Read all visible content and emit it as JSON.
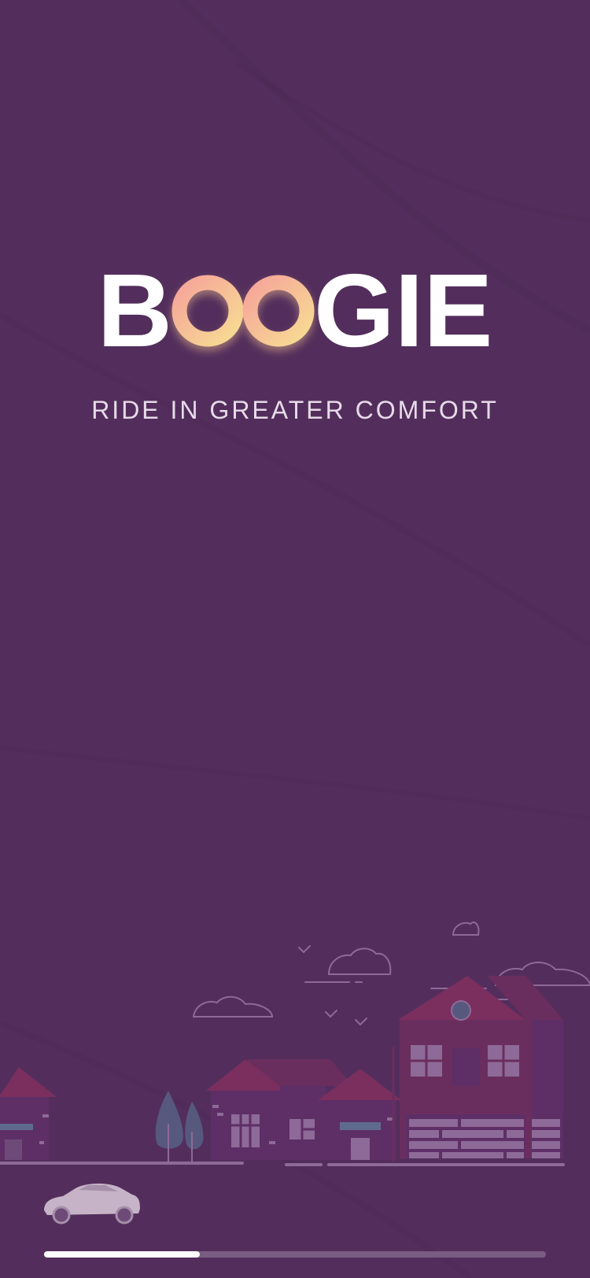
{
  "brand": {
    "letters_before": "B",
    "ring_letters": [
      "O",
      "O"
    ],
    "letters_after": "GIE",
    "ring_gradient": [
      "#f6a49a",
      "#f7dc93"
    ]
  },
  "tagline": "RIDE IN GREATER COMFORT",
  "loading": {
    "progress": 0.31
  },
  "colors": {
    "background": "#532e5c",
    "house_roof": "#7a2f5e",
    "house_body": "#5e2f66",
    "line_art": "#8d6a97",
    "progress_track": "#7a5c82",
    "progress_fill": "#ffffff"
  }
}
